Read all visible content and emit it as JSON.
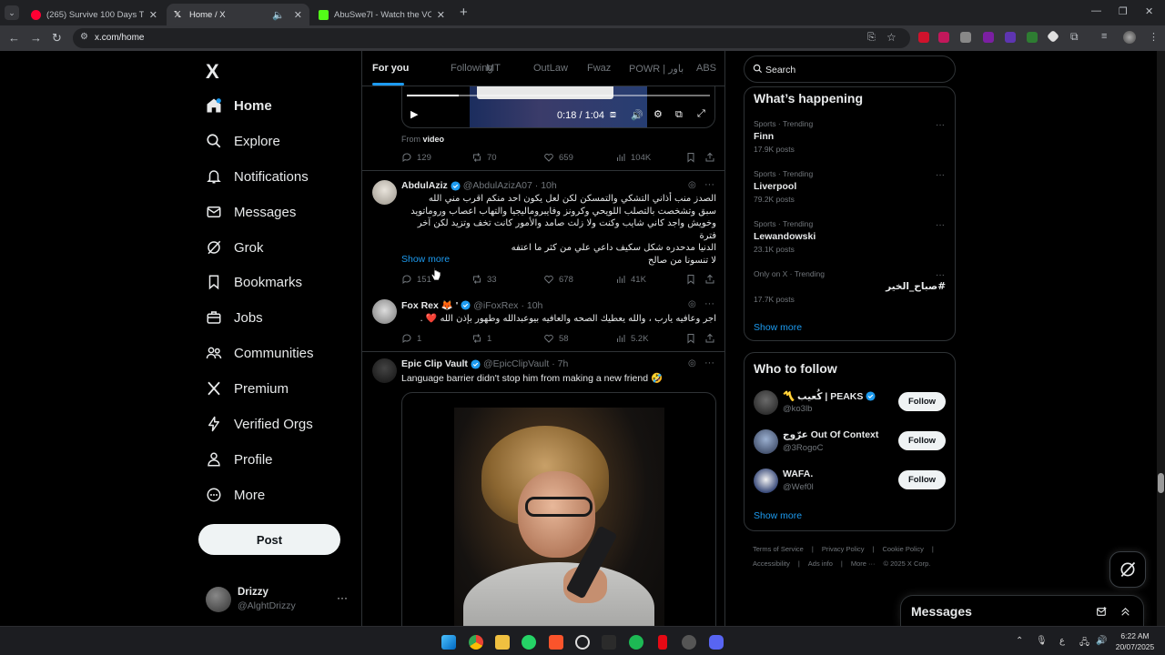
{
  "browser": {
    "tabs": [
      {
        "title": "(265) Survive 100 Days Trapped",
        "active": false,
        "favicon_color": "#ff0033"
      },
      {
        "title": "Home / X",
        "active": true,
        "favicon_color": "#ffffff"
      },
      {
        "title": "AbuSwe7l - Watch the VOD on",
        "active": false,
        "favicon_color": "#53fc18"
      }
    ],
    "url": "x.com/home"
  },
  "sidebar": {
    "logo": "X",
    "items": [
      {
        "label": "Home",
        "icon": "home-icon",
        "active": true
      },
      {
        "label": "Explore",
        "icon": "search-icon"
      },
      {
        "label": "Notifications",
        "icon": "bell-icon"
      },
      {
        "label": "Messages",
        "icon": "envelope-icon"
      },
      {
        "label": "Grok",
        "icon": "grok-icon"
      },
      {
        "label": "Bookmarks",
        "icon": "bookmark-icon"
      },
      {
        "label": "Jobs",
        "icon": "briefcase-icon"
      },
      {
        "label": "Communities",
        "icon": "people-icon"
      },
      {
        "label": "Premium",
        "icon": "x-logo-icon"
      },
      {
        "label": "Verified Orgs",
        "icon": "lightning-icon"
      },
      {
        "label": "Profile",
        "icon": "person-icon"
      },
      {
        "label": "More",
        "icon": "more-circle-icon"
      }
    ],
    "post_button": "Post",
    "account": {
      "name": "Drizzy",
      "handle": "@AlghtDrizzy"
    }
  },
  "feed": {
    "tabs": [
      "For you",
      "Following",
      "MT",
      "OutLaw",
      "Fwaz",
      "POWR | باور",
      "ABS"
    ],
    "active_tab": "For you",
    "video_post": {
      "time": "0:18 / 1:04",
      "progress": 0.17,
      "from_prefix": "From",
      "from_source": "video",
      "stats": {
        "replies": "129",
        "reposts": "70",
        "likes": "659",
        "views": "104K"
      }
    },
    "posts": [
      {
        "name": "AbdulAziz",
        "verified": true,
        "handle": "@AbdulAzizA07",
        "time": "· 10h",
        "text_lines": [
          "الصدز منب أذاني التشكي والتمسكن لكن لعل يكون احد منكم اقرب مني الله",
          "سبق وتشخصت بالتصلب اللويحي وكرونز وفايبروماليجيا والتهاب اعصاب وروماتويد",
          "وخويش واجد كاني شايب وكنت ولا زلت صامد والأمور كانت تخف وتزيد لكن آخر فترة",
          "الدنيا مدحدره شكل سكيف داعي علي من كثر ما اعتفه",
          "لا تنسونا من صالح"
        ],
        "show_more": "Show more",
        "stats": {
          "replies": "151",
          "reposts": "33",
          "likes": "678",
          "views": "41K"
        }
      },
      {
        "name": "Fox Rex 🦊 '",
        "verified": true,
        "handle": "@iFoxRex",
        "time": "· 10h",
        "text": "اجر وعافيه يارب ، والله يعطيك الصحه والعافيه بيوعبدالله وطهور بإذن الله ❤️ .",
        "stats": {
          "replies": "1",
          "reposts": "1",
          "likes": "58",
          "views": "5.2K"
        }
      },
      {
        "name": "Epic Clip Vault",
        "verified": true,
        "handle": "@EpicClipVault",
        "time": "· 7h",
        "text": "Language barrier didn't stop him from making a new friend 🤣"
      }
    ]
  },
  "right": {
    "search_placeholder": "Search",
    "trending": {
      "title": "What’s happening",
      "items": [
        {
          "context": "Sports · Trending",
          "name": "Finn",
          "count": "17.9K posts"
        },
        {
          "context": "Sports · Trending",
          "name": "Liverpool",
          "count": "79.2K posts"
        },
        {
          "context": "Sports · Trending",
          "name": "Lewandowski",
          "count": "23.1K posts"
        },
        {
          "context": "Only on X · Trending",
          "name": "#صباح_الخير",
          "count": "17.7K posts"
        }
      ],
      "show_more": "Show more"
    },
    "who_to_follow": {
      "title": "Who to follow",
      "items": [
        {
          "name": "〽️ كُعيب | PEAKS",
          "verified": true,
          "handle": "@ko3lb",
          "button": "Follow"
        },
        {
          "name": "عرّوج Out Of Context",
          "verified": false,
          "handle": "@3RogoC",
          "button": "Follow"
        },
        {
          "name": "WAFA.",
          "verified": false,
          "handle": "@Wef0l",
          "button": "Follow"
        }
      ],
      "show_more": "Show more"
    },
    "footer_line1": [
      "Terms of Service",
      "|",
      "Privacy Policy",
      "|",
      "Cookie Policy",
      "|"
    ],
    "footer_line2": [
      "Accessibility",
      "|",
      "Ads info",
      "|",
      "More ···",
      "© 2025 X Corp."
    ],
    "messages_drawer": "Messages"
  },
  "taskbar": {
    "time": "6:22 AM",
    "date": "20/07/2025",
    "lang": "ع"
  },
  "colors": {
    "accent": "#1d9bf0",
    "background": "#000000",
    "border": "#2f3336",
    "muted": "#71767b"
  }
}
